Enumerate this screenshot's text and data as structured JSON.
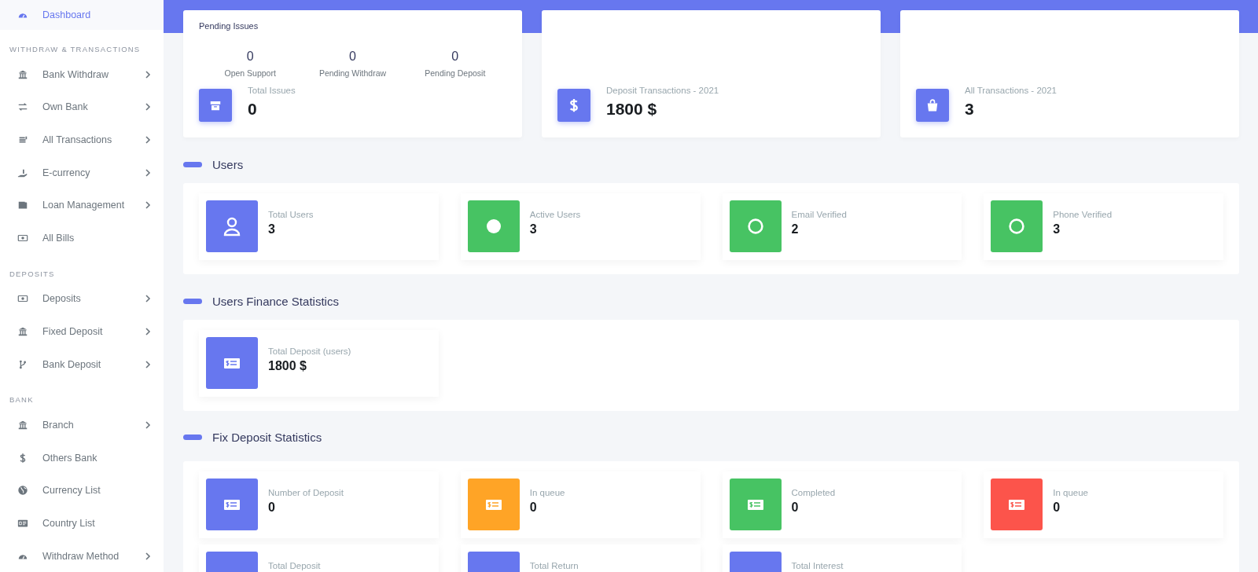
{
  "sidebar": {
    "groups": [
      {
        "items": [
          {
            "label": "Dashboard",
            "selected": true,
            "has_submenu": false
          }
        ]
      },
      {
        "heading": "WITHDRAW & TRANSACTIONS",
        "items": [
          {
            "label": "Bank Withdraw",
            "selected": false,
            "has_submenu": true
          },
          {
            "label": "Own Bank",
            "selected": false,
            "has_submenu": true
          },
          {
            "label": "All Transactions",
            "selected": false,
            "has_submenu": true
          },
          {
            "label": "E-currency",
            "selected": false,
            "has_submenu": true
          },
          {
            "label": "Loan Management",
            "selected": false,
            "has_submenu": true
          },
          {
            "label": "All Bills",
            "selected": false,
            "has_submenu": false
          }
        ]
      },
      {
        "heading": "DEPOSITS",
        "items": [
          {
            "label": "Deposits",
            "selected": false,
            "has_submenu": true
          },
          {
            "label": "Fixed Deposit",
            "selected": false,
            "has_submenu": true
          },
          {
            "label": "Bank Deposit",
            "selected": false,
            "has_submenu": true
          }
        ]
      },
      {
        "heading": "BANK",
        "items": [
          {
            "label": "Branch",
            "selected": false,
            "has_submenu": true
          },
          {
            "label": "Others Bank",
            "selected": false,
            "has_submenu": false
          },
          {
            "label": "Currency List",
            "selected": false,
            "has_submenu": false
          },
          {
            "label": "Country List",
            "selected": false,
            "has_submenu": false
          },
          {
            "label": "Withdraw Method",
            "selected": false,
            "has_submenu": true
          }
        ]
      }
    ]
  },
  "summary_cards": [
    {
      "title": "Pending Issues",
      "stats": [
        {
          "value": "0",
          "label": "Open Support"
        },
        {
          "value": "0",
          "label": "Pending Withdraw"
        },
        {
          "value": "0",
          "label": "Pending Deposit"
        }
      ],
      "label": "Total Issues",
      "value": "0"
    },
    {
      "label": "Deposit Transactions - 2021",
      "value": "1800 $"
    },
    {
      "label": "All Transactions - 2021",
      "value": "3"
    }
  ],
  "sections": [
    {
      "title": "Users",
      "tiles": [
        {
          "label": "Total Users",
          "value": "3",
          "color": "#6777ef"
        },
        {
          "label": "Active Users",
          "value": "3",
          "color": "#47c363"
        },
        {
          "label": "Email Verified",
          "value": "2",
          "color": "#47c363"
        },
        {
          "label": "Phone Verified",
          "value": "3",
          "color": "#47c363"
        }
      ]
    },
    {
      "title": "Users Finance Statistics",
      "tiles": [
        {
          "label": "Total Deposit (users)",
          "value": "1800 $",
          "color": "#6777ef"
        }
      ]
    },
    {
      "title": "Fix Deposit Statistics",
      "tiles": [
        {
          "label": "Number of Deposit",
          "value": "0",
          "color": "#6777ef"
        },
        {
          "label": "In queue",
          "value": "0",
          "color": "#ffa426"
        },
        {
          "label": "Completed",
          "value": "0",
          "color": "#47c363"
        },
        {
          "label": "In queue",
          "value": "0",
          "color": "#fc544b"
        },
        {
          "label": "Total Deposit",
          "color": "#6777ef"
        },
        {
          "label": "Total Return",
          "color": "#6777ef"
        },
        {
          "label": "Total Interest",
          "color": "#6777ef"
        }
      ]
    }
  ]
}
